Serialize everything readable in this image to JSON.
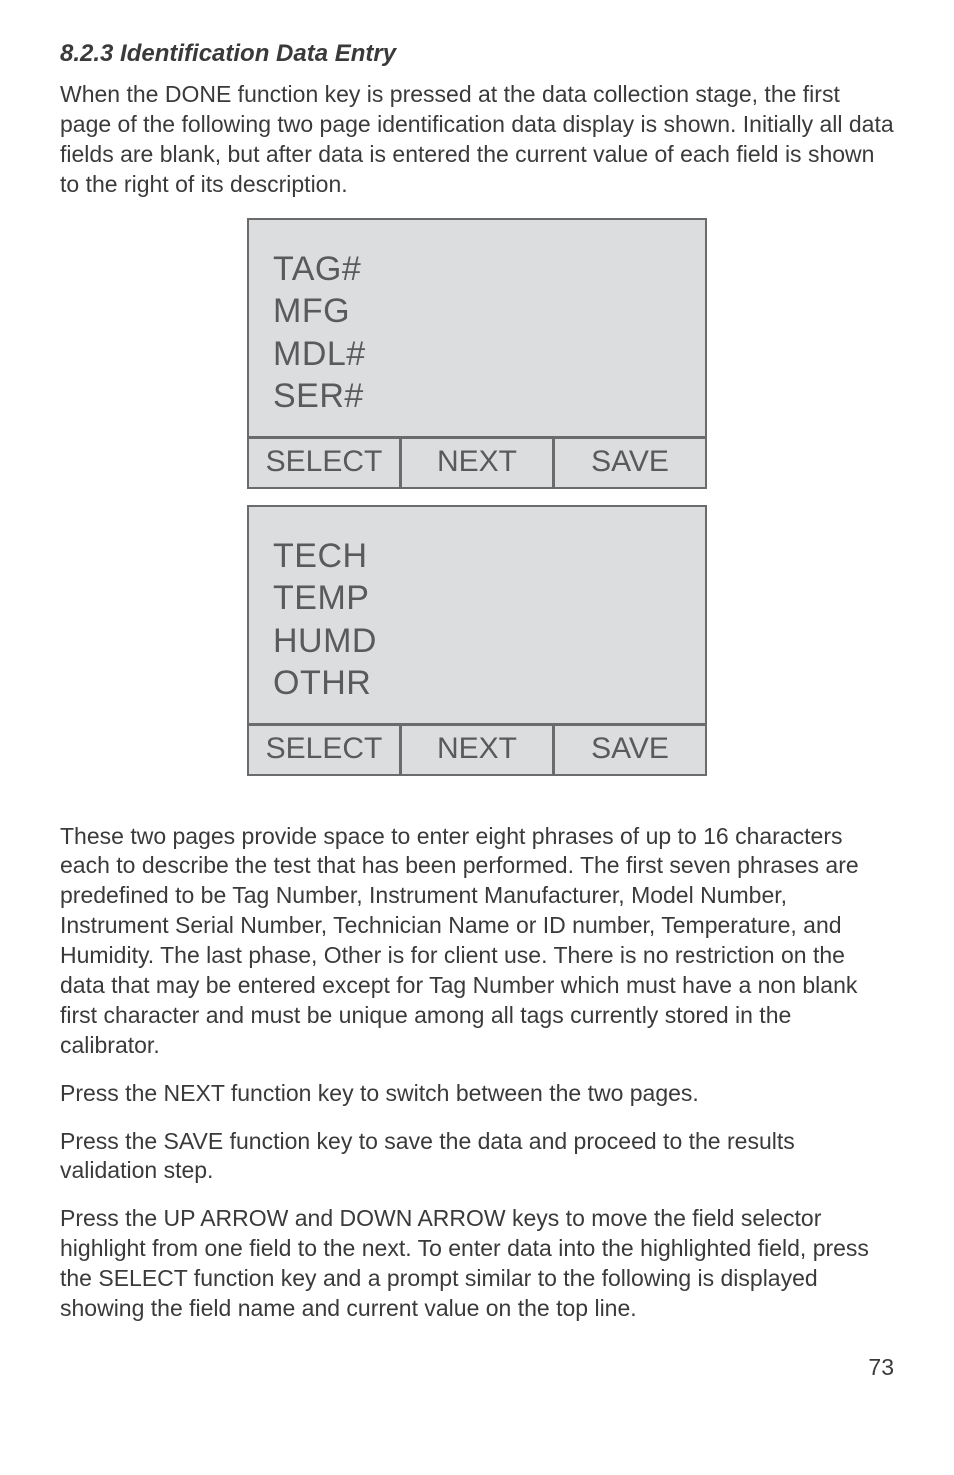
{
  "section_title": "8.2.3 Identification Data Entry",
  "intro_paragraph": "When the DONE function key is pressed at the data collection stage, the first page of the following two page identification data display is shown. Initially all data fields are blank, but after data is entered the current value of each field is shown to the right of its description.",
  "screen1": {
    "lines": [
      "TAG#",
      "MFG",
      "MDL#",
      "SER#"
    ],
    "softkeys": [
      "SELECT",
      "NEXT",
      "SAVE"
    ]
  },
  "screen2": {
    "lines": [
      "TECH",
      "TEMP",
      "HUMD",
      "OTHR"
    ],
    "softkeys": [
      "SELECT",
      "NEXT",
      "SAVE"
    ]
  },
  "para2": "These two pages provide space to enter eight phrases of up to 16 characters each to describe the test that has been performed. The first seven phrases are predefined to be Tag Number, Instrument Manufacturer, Model Number, Instrument Serial Number, Technician Name or ID number, Temperature, and Humidity.  The last phase, Other is for client use. There is no restriction on the data that may be entered except for Tag Number which must have a non blank first character and must be unique among all tags currently stored in the calibrator.",
  "para3": "Press the NEXT function key to switch between the two pages.",
  "para4": "Press the SAVE function key to save the data and proceed to the results validation step.",
  "para5": "Press the UP ARROW and DOWN ARROW keys to move the field selector highlight from one field to the next. To enter data into the highlighted field, press the SELECT function key and a prompt similar to the following is displayed showing the field name and current value on the top line.",
  "page_number": "73"
}
